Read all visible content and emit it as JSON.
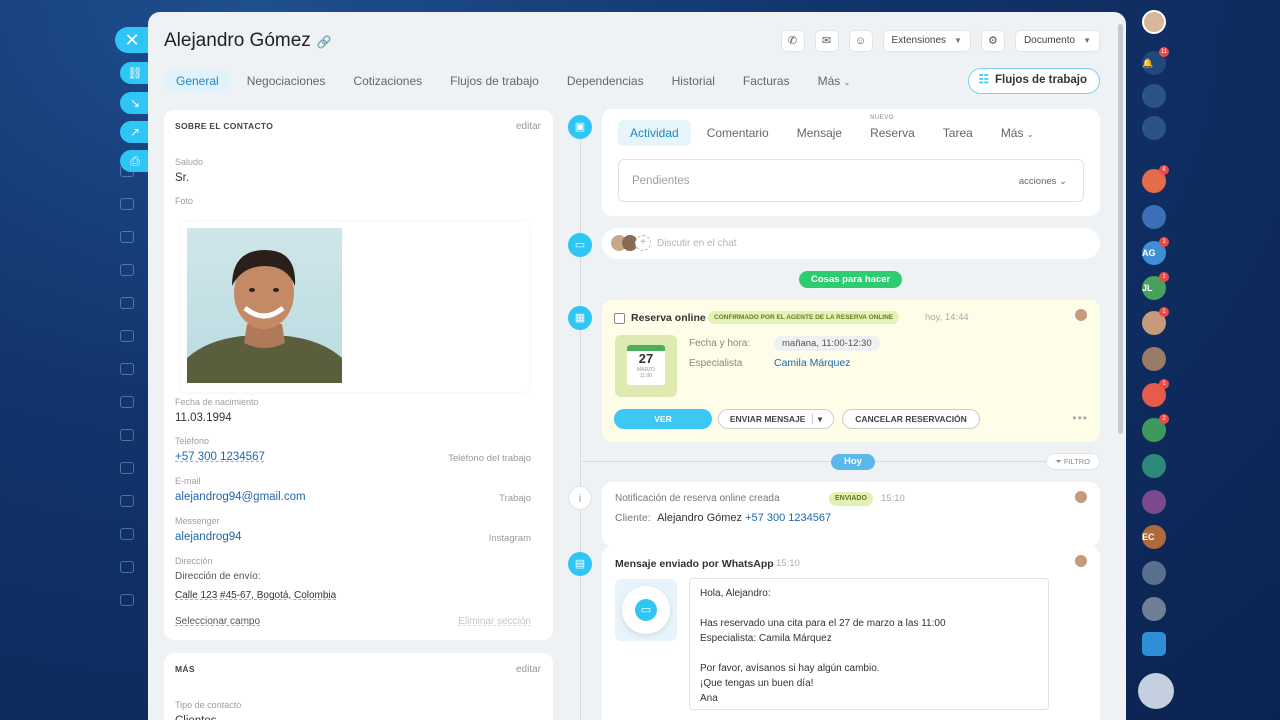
{
  "header": {
    "title": "Alejandro Gómez",
    "extensions_label": "Extensiones",
    "document_label": "Documento"
  },
  "tabs": [
    {
      "label": "General"
    },
    {
      "label": "Negociaciones"
    },
    {
      "label": "Cotizaciones"
    },
    {
      "label": "Flujos de trabajo"
    },
    {
      "label": "Dependencias"
    },
    {
      "label": "Historial"
    },
    {
      "label": "Facturas"
    },
    {
      "label": "Más"
    }
  ],
  "flujos_button": "Flujos de trabajo",
  "about": {
    "heading": "SOBRE EL CONTACTO",
    "edit": "editar",
    "salutation_label": "Saludo",
    "salutation": "Sr.",
    "photo_label": "Foto",
    "birth_label": "Fecha de nacimiento",
    "birth": "11.03.1994",
    "phone_label": "Teléfono",
    "phone": "+57 300 1234567",
    "phone_type": "Teléfono del trabajo",
    "email_label": "E-mail",
    "email": "alejandrog94@gmail.com",
    "email_type": "Trabajo",
    "messenger_label": "Messenger",
    "messenger": "alejandrog94",
    "messenger_type": "Instagram",
    "address_label": "Dirección",
    "shipping_label": "Dirección de envío:",
    "shipping": "Calle 123 #45-67, Bogotá, Colombia",
    "select_field": "Seleccionar campo",
    "delete_section": "Eliminar sección"
  },
  "more": {
    "heading": "MÁS",
    "edit": "editar",
    "contact_type_label": "Tipo de contacto",
    "contact_type": "Clientes"
  },
  "activity": {
    "tabs": [
      {
        "label": "Actividad"
      },
      {
        "label": "Comentario"
      },
      {
        "label": "Mensaje"
      },
      {
        "label": "Reserva",
        "new": "NUEVO"
      },
      {
        "label": "Tarea"
      },
      {
        "label": "Más"
      }
    ],
    "pending_placeholder": "Pendientes",
    "actions": "acciones"
  },
  "chat": {
    "placeholder": "Discutir en el chat"
  },
  "todo_pill": "Cosas para hacer",
  "reservation": {
    "title": "Reserva online",
    "badge": "CONFIRMADO POR EL AGENTE DE LA RESERVA ONLINE",
    "time": "hoy, 14:44",
    "cal_day": "27",
    "cal_month": "MARZO",
    "cal_time": "11:00",
    "datetime_label": "Fecha y hora:",
    "datetime": "mañana, 11:00-12:30",
    "specialist_label": "Especialista",
    "specialist": "Camila Márquez",
    "btn_view": "VER",
    "btn_send": "ENVIAR MENSAJE",
    "btn_cancel": "CANCELAR RESERVACIÓN"
  },
  "today": {
    "label": "Hoy",
    "filter": "FILTRO"
  },
  "notification": {
    "title": "Notificación de reserva online creada",
    "badge": "ENVIADO",
    "time": "15:10",
    "client_label": "Cliente:",
    "client_name": "Alejandro Gómez",
    "client_phone": "+57 300 1234567"
  },
  "whatsapp": {
    "title": "Mensaje enviado por WhatsApp",
    "time": "15:10",
    "lines": [
      "Hola, Alejandro:",
      "",
      "Has reservado una cita para el 27 de marzo a las 11:00",
      "Especialista: Camila Márquez",
      "",
      "Por favor, avísanos si hay algún cambio.",
      "¡Que tengas un buen día!",
      "Ana"
    ]
  },
  "right_rail": {
    "badges": [
      "11",
      "4",
      "1",
      "1",
      "1",
      "1",
      "2"
    ],
    "initials": [
      "AG",
      "JL",
      "EC"
    ]
  },
  "colors": {
    "accent": "#2fc6f6",
    "link": "#2067b0",
    "green": "#2ecc71",
    "bg_dark": "#12346c"
  }
}
